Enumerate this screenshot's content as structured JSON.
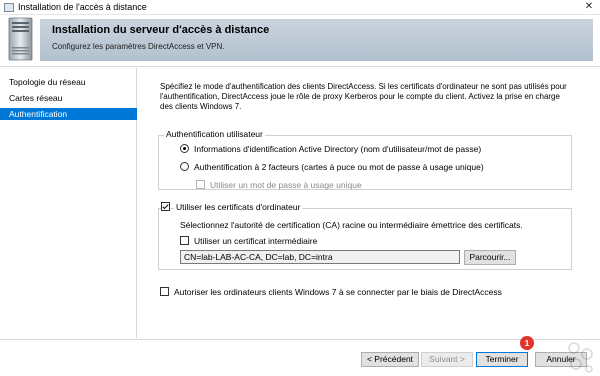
{
  "window": {
    "title": "Installation de l'accès à distance",
    "close_glyph": "✕"
  },
  "header": {
    "title": "Installation du serveur d'accès à distance",
    "subtitle": "Configurez les paramètres DirectAccess et VPN."
  },
  "nav": {
    "items": [
      {
        "label": "Topologie du réseau",
        "active": false
      },
      {
        "label": "Cartes réseau",
        "active": false
      },
      {
        "label": "Authentification",
        "active": true
      }
    ]
  },
  "content": {
    "description": "Spécifiez le mode d'authentification des clients DirectAccess. Si les certificats d'ordinateur ne sont pas utilisés pour l'authentification, DirectAccess joue le rôle de proxy Kerberos pour le compte du client. Activez la prise en charge des clients Windows 7.",
    "user_auth": {
      "legend": "Authentification utilisateur",
      "option_ad": "Informations d'identification Active Directory (nom d'utilisateur/mot de passe)",
      "option_2fa": "Authentification à 2 facteurs (cartes à puce ou mot de passe à usage unique)",
      "otp_label": "Utiliser un mot de passe à usage unique",
      "selected": "ad"
    },
    "computer_certs": {
      "label": "Utiliser les certificats d'ordinateur",
      "checked": true,
      "info": "Sélectionnez l'autorité de certification (CA) racine ou intermédiaire émettrice des certificats.",
      "intermediate_label": "Utiliser un certificat intermédiaire",
      "intermediate_checked": false,
      "ca_value": "CN=lab-LAB-AC-CA, DC=lab, DC=intra",
      "browse_label": "Parcourir..."
    },
    "win7": {
      "label": "Autoriser les ordinateurs clients Windows 7 à se connecter par le biais de DirectAccess",
      "checked": false
    }
  },
  "footer": {
    "previous": "< Précédent",
    "next": "Suivant >",
    "finish": "Terminer",
    "cancel": "Annuler"
  },
  "annotation": {
    "badge_number": "1",
    "badge_color": "#e3322a"
  },
  "colors": {
    "accent": "#0078d7",
    "banner": "#c0ccd8"
  }
}
